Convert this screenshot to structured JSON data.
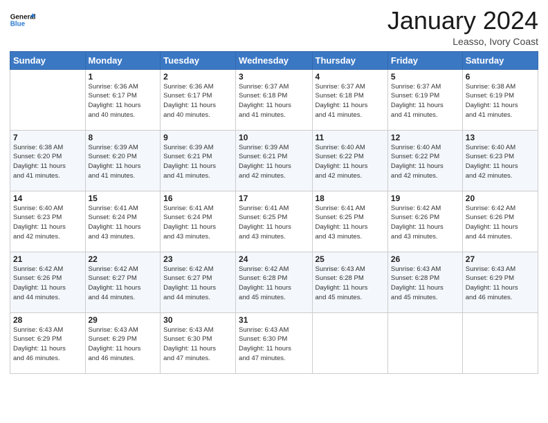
{
  "logo": {
    "line1": "General",
    "line2": "Blue"
  },
  "header": {
    "month": "January 2024",
    "location": "Leasso, Ivory Coast"
  },
  "weekdays": [
    "Sunday",
    "Monday",
    "Tuesday",
    "Wednesday",
    "Thursday",
    "Friday",
    "Saturday"
  ],
  "weeks": [
    [
      {
        "day": "",
        "info": ""
      },
      {
        "day": "1",
        "info": "Sunrise: 6:36 AM\nSunset: 6:17 PM\nDaylight: 11 hours\nand 40 minutes."
      },
      {
        "day": "2",
        "info": "Sunrise: 6:36 AM\nSunset: 6:17 PM\nDaylight: 11 hours\nand 40 minutes."
      },
      {
        "day": "3",
        "info": "Sunrise: 6:37 AM\nSunset: 6:18 PM\nDaylight: 11 hours\nand 41 minutes."
      },
      {
        "day": "4",
        "info": "Sunrise: 6:37 AM\nSunset: 6:18 PM\nDaylight: 11 hours\nand 41 minutes."
      },
      {
        "day": "5",
        "info": "Sunrise: 6:37 AM\nSunset: 6:19 PM\nDaylight: 11 hours\nand 41 minutes."
      },
      {
        "day": "6",
        "info": "Sunrise: 6:38 AM\nSunset: 6:19 PM\nDaylight: 11 hours\nand 41 minutes."
      }
    ],
    [
      {
        "day": "7",
        "info": "Sunrise: 6:38 AM\nSunset: 6:20 PM\nDaylight: 11 hours\nand 41 minutes."
      },
      {
        "day": "8",
        "info": "Sunrise: 6:39 AM\nSunset: 6:20 PM\nDaylight: 11 hours\nand 41 minutes."
      },
      {
        "day": "9",
        "info": "Sunrise: 6:39 AM\nSunset: 6:21 PM\nDaylight: 11 hours\nand 41 minutes."
      },
      {
        "day": "10",
        "info": "Sunrise: 6:39 AM\nSunset: 6:21 PM\nDaylight: 11 hours\nand 42 minutes."
      },
      {
        "day": "11",
        "info": "Sunrise: 6:40 AM\nSunset: 6:22 PM\nDaylight: 11 hours\nand 42 minutes."
      },
      {
        "day": "12",
        "info": "Sunrise: 6:40 AM\nSunset: 6:22 PM\nDaylight: 11 hours\nand 42 minutes."
      },
      {
        "day": "13",
        "info": "Sunrise: 6:40 AM\nSunset: 6:23 PM\nDaylight: 11 hours\nand 42 minutes."
      }
    ],
    [
      {
        "day": "14",
        "info": "Sunrise: 6:40 AM\nSunset: 6:23 PM\nDaylight: 11 hours\nand 42 minutes."
      },
      {
        "day": "15",
        "info": "Sunrise: 6:41 AM\nSunset: 6:24 PM\nDaylight: 11 hours\nand 43 minutes."
      },
      {
        "day": "16",
        "info": "Sunrise: 6:41 AM\nSunset: 6:24 PM\nDaylight: 11 hours\nand 43 minutes."
      },
      {
        "day": "17",
        "info": "Sunrise: 6:41 AM\nSunset: 6:25 PM\nDaylight: 11 hours\nand 43 minutes."
      },
      {
        "day": "18",
        "info": "Sunrise: 6:41 AM\nSunset: 6:25 PM\nDaylight: 11 hours\nand 43 minutes."
      },
      {
        "day": "19",
        "info": "Sunrise: 6:42 AM\nSunset: 6:26 PM\nDaylight: 11 hours\nand 43 minutes."
      },
      {
        "day": "20",
        "info": "Sunrise: 6:42 AM\nSunset: 6:26 PM\nDaylight: 11 hours\nand 44 minutes."
      }
    ],
    [
      {
        "day": "21",
        "info": "Sunrise: 6:42 AM\nSunset: 6:26 PM\nDaylight: 11 hours\nand 44 minutes."
      },
      {
        "day": "22",
        "info": "Sunrise: 6:42 AM\nSunset: 6:27 PM\nDaylight: 11 hours\nand 44 minutes."
      },
      {
        "day": "23",
        "info": "Sunrise: 6:42 AM\nSunset: 6:27 PM\nDaylight: 11 hours\nand 44 minutes."
      },
      {
        "day": "24",
        "info": "Sunrise: 6:42 AM\nSunset: 6:28 PM\nDaylight: 11 hours\nand 45 minutes."
      },
      {
        "day": "25",
        "info": "Sunrise: 6:43 AM\nSunset: 6:28 PM\nDaylight: 11 hours\nand 45 minutes."
      },
      {
        "day": "26",
        "info": "Sunrise: 6:43 AM\nSunset: 6:28 PM\nDaylight: 11 hours\nand 45 minutes."
      },
      {
        "day": "27",
        "info": "Sunrise: 6:43 AM\nSunset: 6:29 PM\nDaylight: 11 hours\nand 46 minutes."
      }
    ],
    [
      {
        "day": "28",
        "info": "Sunrise: 6:43 AM\nSunset: 6:29 PM\nDaylight: 11 hours\nand 46 minutes."
      },
      {
        "day": "29",
        "info": "Sunrise: 6:43 AM\nSunset: 6:29 PM\nDaylight: 11 hours\nand 46 minutes."
      },
      {
        "day": "30",
        "info": "Sunrise: 6:43 AM\nSunset: 6:30 PM\nDaylight: 11 hours\nand 47 minutes."
      },
      {
        "day": "31",
        "info": "Sunrise: 6:43 AM\nSunset: 6:30 PM\nDaylight: 11 hours\nand 47 minutes."
      },
      {
        "day": "",
        "info": ""
      },
      {
        "day": "",
        "info": ""
      },
      {
        "day": "",
        "info": ""
      }
    ]
  ]
}
